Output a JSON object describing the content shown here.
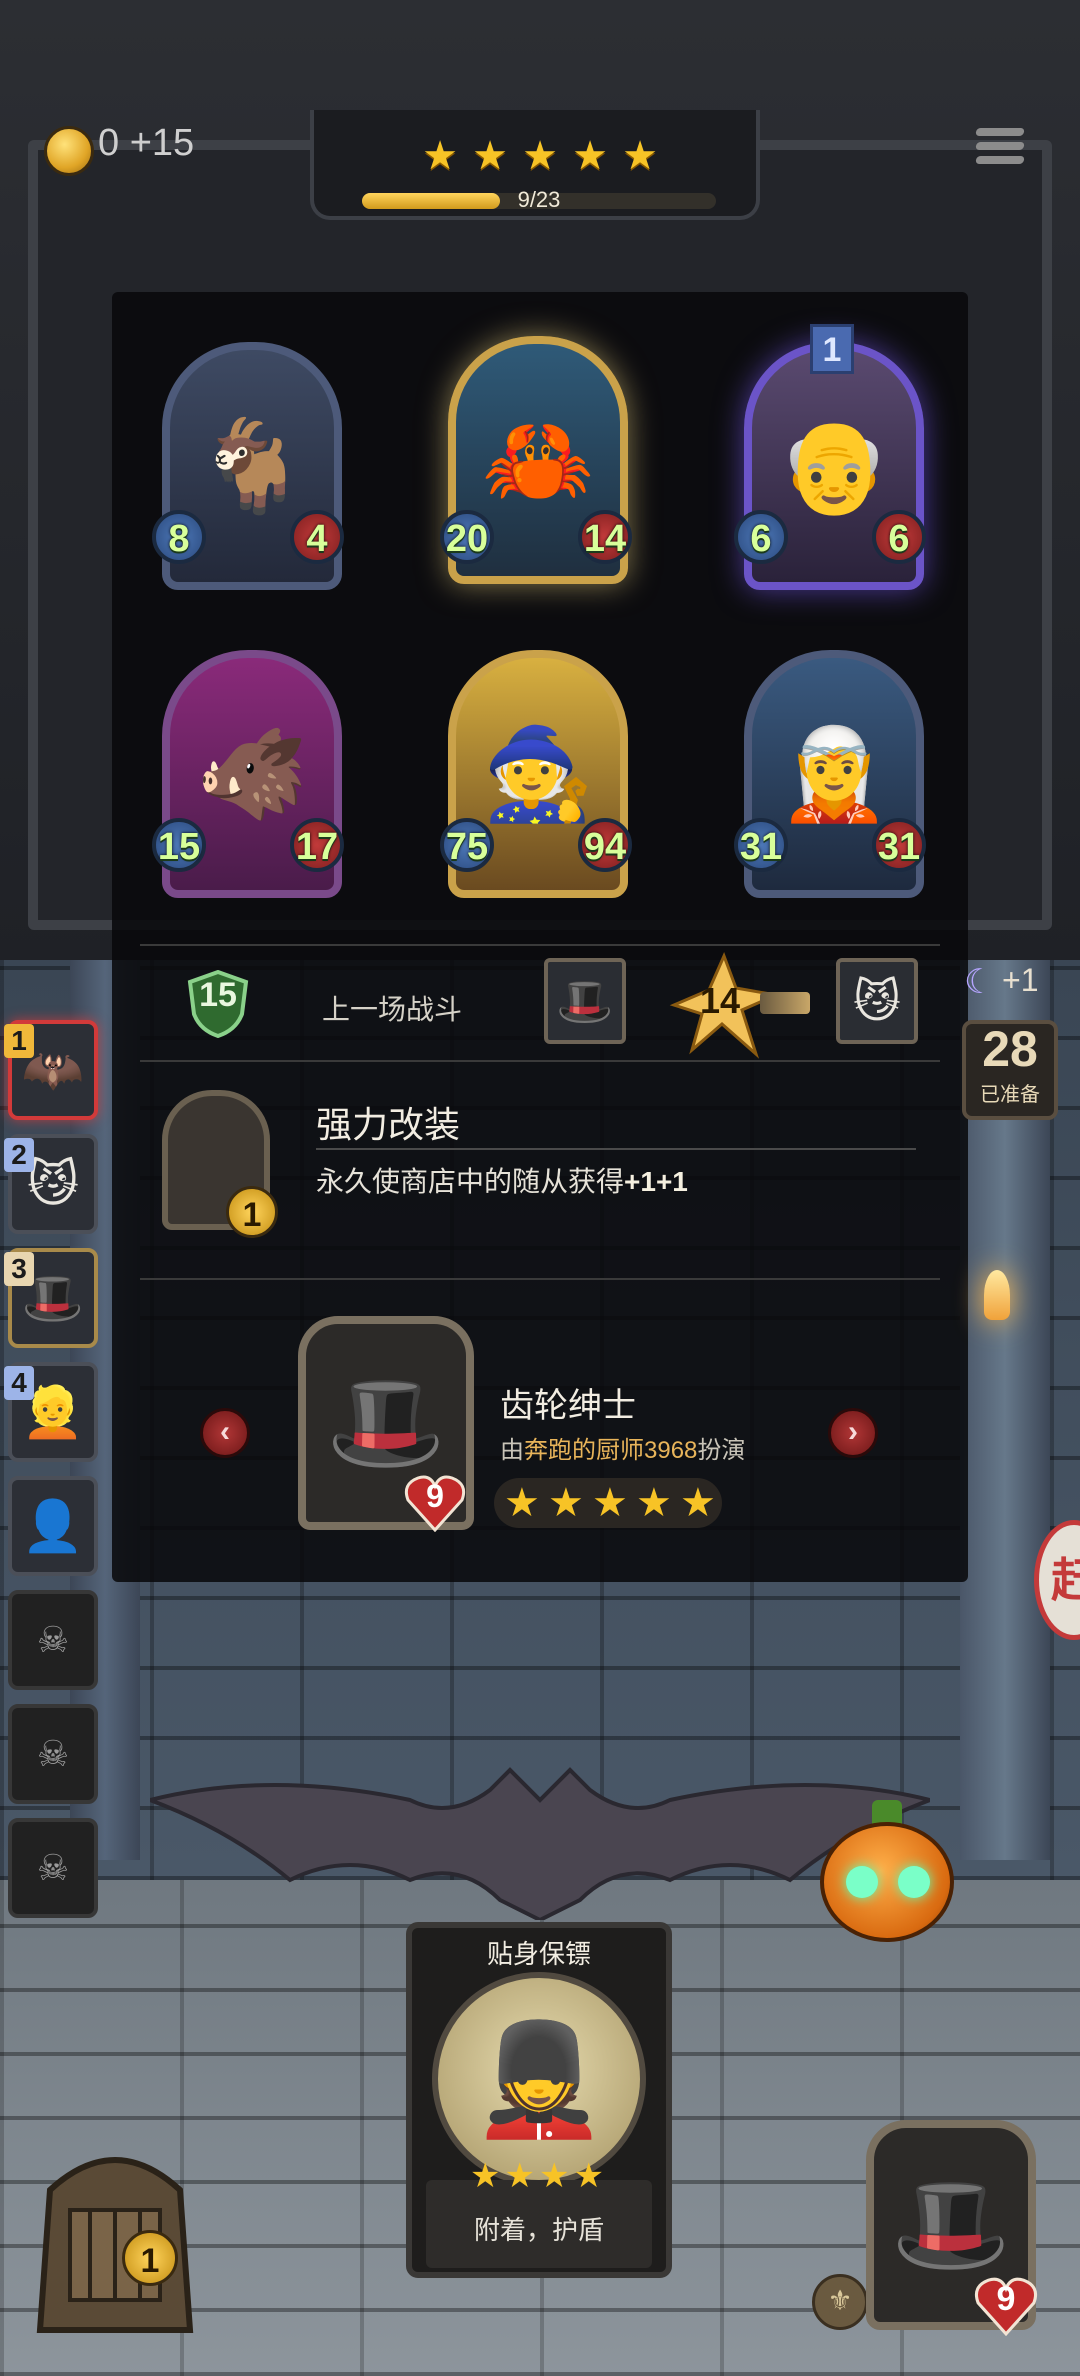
{
  "top_bar": {
    "gold": "0",
    "income": "+15",
    "star_count": 5,
    "progress_text": "9/23",
    "progress_ratio": 0.391
  },
  "shop_minions": [
    {
      "name": "goat-wizard",
      "attack": "8",
      "health": "4",
      "frame": "blue",
      "icon": "goat"
    },
    {
      "name": "crystal-crab",
      "attack": "20",
      "health": "14",
      "frame": "gold",
      "icon": "crab"
    },
    {
      "name": "old-man",
      "attack": "6",
      "health": "6",
      "frame": "purple",
      "icon": "old-man",
      "tier": "1"
    },
    {
      "name": "beast",
      "attack": "15",
      "health": "17",
      "frame": "pink",
      "icon": "beast"
    },
    {
      "name": "blonde-hero",
      "attack": "75",
      "health": "94",
      "frame": "gold",
      "icon": "hero"
    },
    {
      "name": "blue-mage",
      "attack": "31",
      "health": "31",
      "frame": "blue",
      "icon": "mage"
    }
  ],
  "battle": {
    "shield_value": "15",
    "label": "上一场战斗",
    "damage": "14"
  },
  "upgrade": {
    "title": "强力改装",
    "badge": "1",
    "desc_prefix": "永久使商店中的随从获得",
    "desc_bonus": "+1+1"
  },
  "hero": {
    "name": "齿轮绅士",
    "by": "由",
    "player": "奔跑的厨师3968",
    "played": "扮演",
    "health": "9",
    "stars": 5
  },
  "sidebar": [
    {
      "num": "1",
      "state": "active",
      "icon": "bat-warrior"
    },
    {
      "num": "2",
      "state": "normal",
      "icon": "cat-demon"
    },
    {
      "num": "3",
      "state": "normal",
      "icon": "gear-gentleman"
    },
    {
      "num": "4",
      "state": "normal",
      "icon": "blonde-girl"
    },
    {
      "num": "",
      "state": "normal",
      "icon": "hooded"
    },
    {
      "num": "",
      "state": "dead",
      "icon": "skull"
    },
    {
      "num": "",
      "state": "dead",
      "icon": "skull"
    },
    {
      "num": "",
      "state": "dead",
      "icon": "skull"
    }
  ],
  "right_panel": {
    "bonus": "+1",
    "ready_count": "28",
    "ready_label": "已准备",
    "go_glyph": "赶"
  },
  "featured_card": {
    "title": "贴身保镖",
    "stars": "★★★★",
    "desc": "附着，护盾"
  },
  "chest": {
    "count": "1"
  },
  "player": {
    "health": "9"
  }
}
